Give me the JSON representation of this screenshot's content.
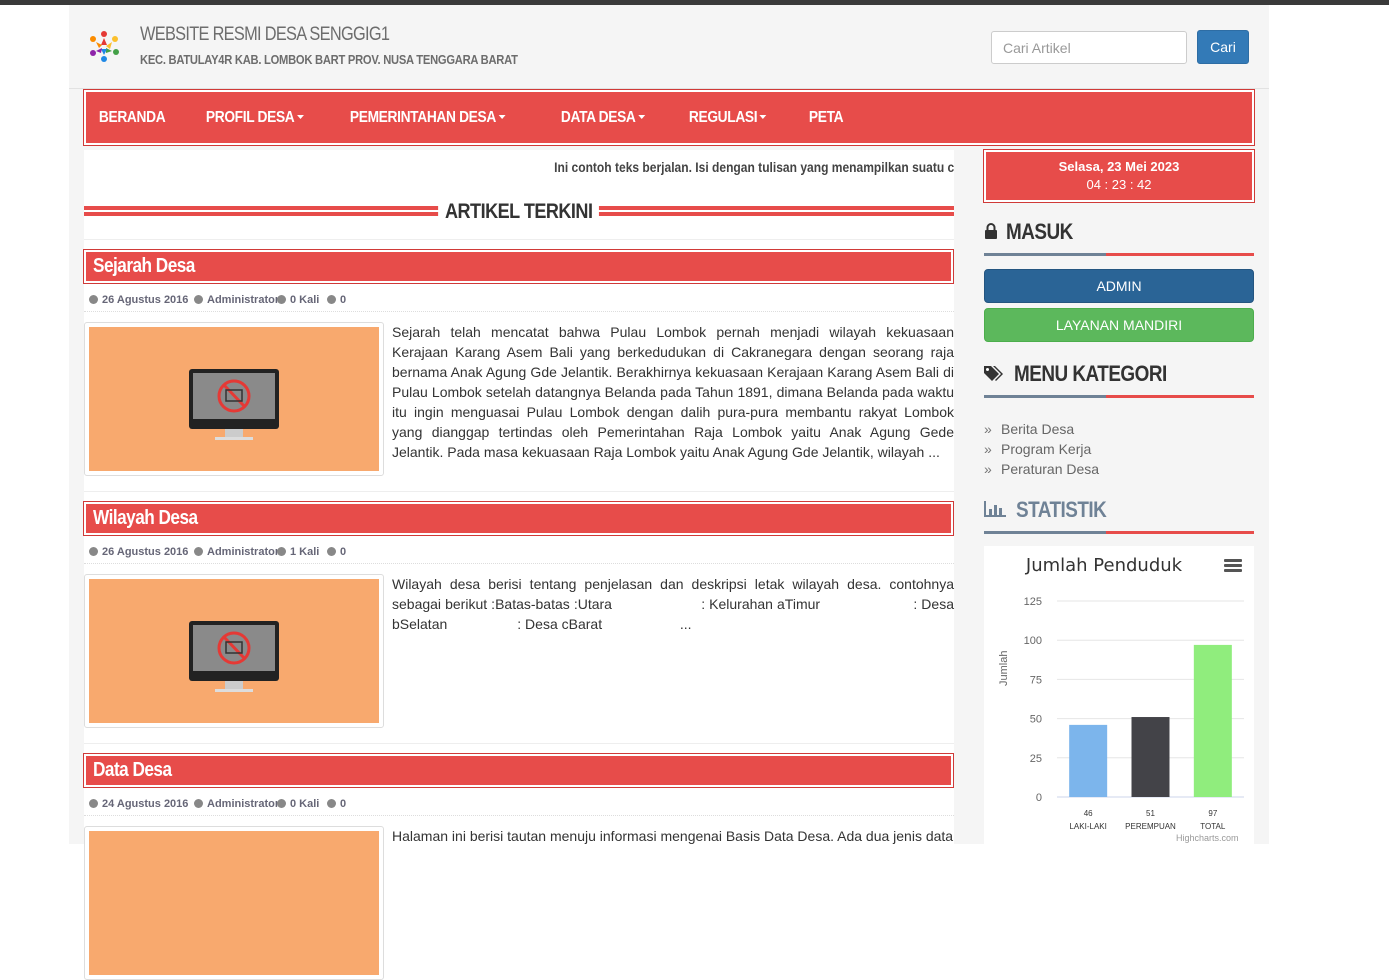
{
  "header": {
    "title": "WEBSITE RESMI DESA SENGGIG1",
    "subtitle": "KEC. BATULAY4R KAB. LOMBOK BART PROV. NUSA TENGGARA BARAT",
    "search_placeholder": "Cari Artikel",
    "search_button": "Cari"
  },
  "nav": {
    "items": [
      {
        "label": "BERANDA",
        "dropdown": false
      },
      {
        "label": "PROFIL DESA",
        "dropdown": true
      },
      {
        "label": "PEMERINTAHAN DESA",
        "dropdown": true
      },
      {
        "label": "DATA DESA",
        "dropdown": true
      },
      {
        "label": "REGULASI",
        "dropdown": true
      },
      {
        "label": "PETA",
        "dropdown": false
      }
    ]
  },
  "marquee": "Ini contoh teks berjalan. Isi dengan tulisan yang menampilkan suatu c",
  "section_title": "ARTIKEL TERKINI",
  "articles": [
    {
      "title": "Sejarah Desa",
      "date": "26 Agustus 2016",
      "author": "Administrator",
      "views": "0 Kali",
      "comments": "0",
      "excerpt": "Sejarah telah mencatat bahwa Pulau Lombok pernah menjadi wilayah kekuasaan Kerajaan Karang Asem Bali yang berkedudukan di Cakranegara dengan seorang raja bernama Anak Agung Gde Jelantik. Berakhirnya kekuasaan Kerajaan Karang Asem Bali di Pulau Lombok setelah datangnya Belanda pada Tahun 1891, dimana Belanda pada waktu itu ingin menguasai Pulau Lombok dengan dalih pura-pura membantu rakyat Lombok yang dianggap tertindas oleh Pemerintahan Raja Lombok yaitu Anak Agung Gede Jelantik. Pada masa kekuasaan Raja Lombok yaitu Anak Agung Gde Jelantik, wilayah ..."
    },
    {
      "title": "Wilayah Desa",
      "date": "26 Agustus 2016",
      "author": "Administrator",
      "views": "1 Kali",
      "comments": "0",
      "excerpt": "Wilayah desa berisi tentang penjelasan dan deskripsi letak wilayah desa. contohnya sebagai berikut :Batas-batas :Utara                      : Kelurahan aTimur                       : Desa bSelatan                  : Desa cBarat                    ..."
    },
    {
      "title": "Data Desa",
      "date": "24 Agustus 2016",
      "author": "Administrator",
      "views": "0 Kali",
      "comments": "0",
      "excerpt": "Halaman ini berisi tautan menuju informasi mengenai Basis Data Desa. Ada dua jenis data"
    }
  ],
  "sidebar": {
    "date": "Selasa, 23 Mei 2023",
    "time": "04 : 23 : 42",
    "masuk_title": "MASUK",
    "admin_button": "ADMIN",
    "layanan_button": "LAYANAN MANDIRI",
    "kategori_title": "MENU KATEGORI",
    "kategori": [
      "Berita Desa",
      "Program Kerja",
      "Peraturan Desa"
    ],
    "statistik_title": "STATISTIK"
  },
  "colors": {
    "accent": "#e74c4a",
    "admin_btn": "#2a6496",
    "layanan_btn": "#5cb85c",
    "search_btn": "#337ab7"
  },
  "chart_data": {
    "type": "bar",
    "title": "Jumlah Penduduk",
    "ylabel": "Jumlah",
    "ylim": [
      0,
      125
    ],
    "yticks": [
      0,
      25,
      50,
      75,
      100,
      125
    ],
    "categories": [
      "LAKI-LAKI",
      "PEREMPUAN",
      "TOTAL"
    ],
    "values": [
      46,
      51,
      97
    ],
    "colors": [
      "#7cb5ec",
      "#434348",
      "#90ed7d"
    ],
    "credits": "Highcharts.com",
    "grid": true
  }
}
